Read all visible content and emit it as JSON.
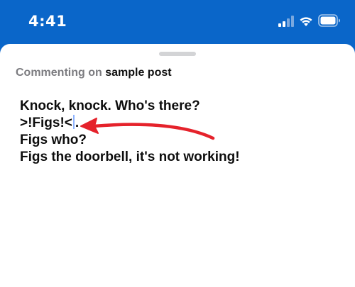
{
  "status_bar": {
    "time": "4:41",
    "icons": [
      "signal-icon",
      "wifi-icon",
      "battery-icon"
    ],
    "background": "#0a66c9"
  },
  "sheet": {
    "header": {
      "prefix": "Commenting on",
      "post_title": "sample post"
    },
    "comment": {
      "line1": "Knock, knock. Who's there?",
      "line2_before_caret": ">!Figs!<",
      "line2_after_caret": ".",
      "line3": "Figs who?",
      "line4": "Figs the doorbell, it's not working!"
    },
    "annotation": {
      "type": "arrow",
      "color": "#e5222b",
      "points_to": "text-caret"
    }
  }
}
